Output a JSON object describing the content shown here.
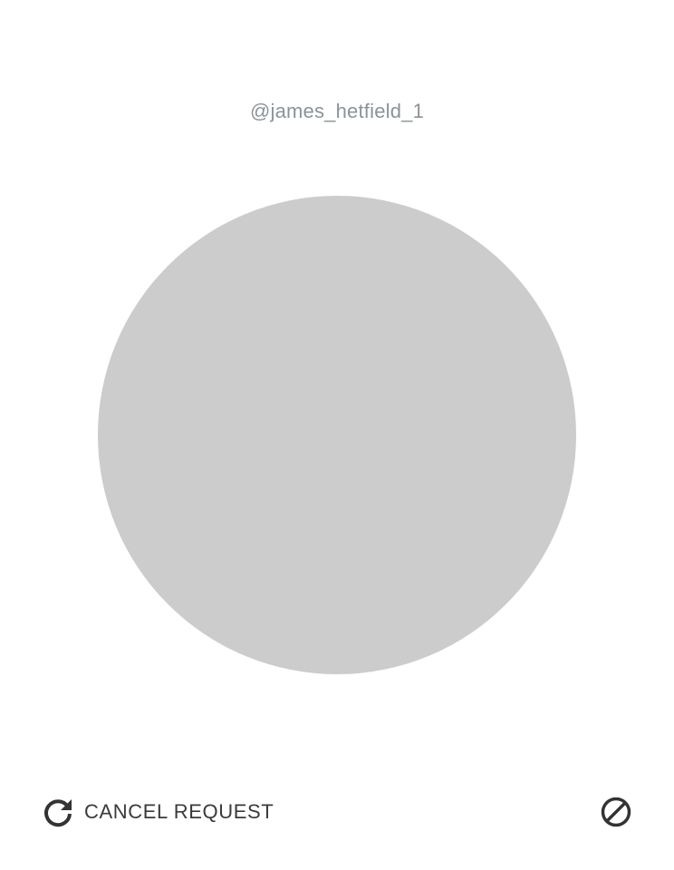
{
  "profile": {
    "username": "@james_hetfield_1",
    "avatar_color": "#cccccc"
  },
  "actions": {
    "cancel_request_label": "CANCEL REQUEST",
    "cancel_request_icon": "refresh-icon",
    "block_icon": "block-icon"
  },
  "colors": {
    "username_text": "#8a9399",
    "action_text": "#3a3a3a",
    "icon": "#333333",
    "background": "#ffffff"
  }
}
